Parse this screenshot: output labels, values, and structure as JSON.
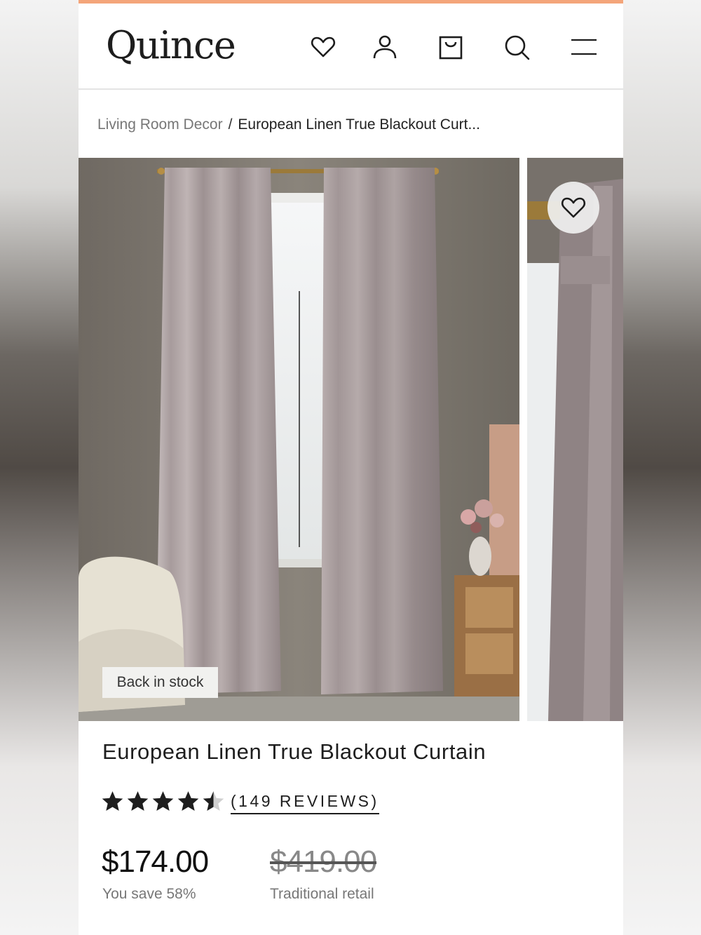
{
  "header": {
    "logo": "Quince",
    "icons": [
      "heart-icon",
      "account-icon",
      "cart-icon",
      "search-icon",
      "menu-icon"
    ]
  },
  "breadcrumb": {
    "parent": "Living Room Decor",
    "separator": "/",
    "current": "European Linen True Blackout Curt..."
  },
  "gallery": {
    "badge": "Back in stock"
  },
  "product": {
    "title": "European Linen True Blackout Curtain",
    "rating": 4.5,
    "reviews_label": "(149 REVIEWS)",
    "price": "$174.00",
    "savings": "You save 58%",
    "retail_price": "$419.00",
    "retail_label": "Traditional retail"
  },
  "colors": {
    "accent_bar": "#f4a57a",
    "text": "#1e1e1e",
    "muted": "#777777",
    "curtain": "#a89a9c"
  }
}
